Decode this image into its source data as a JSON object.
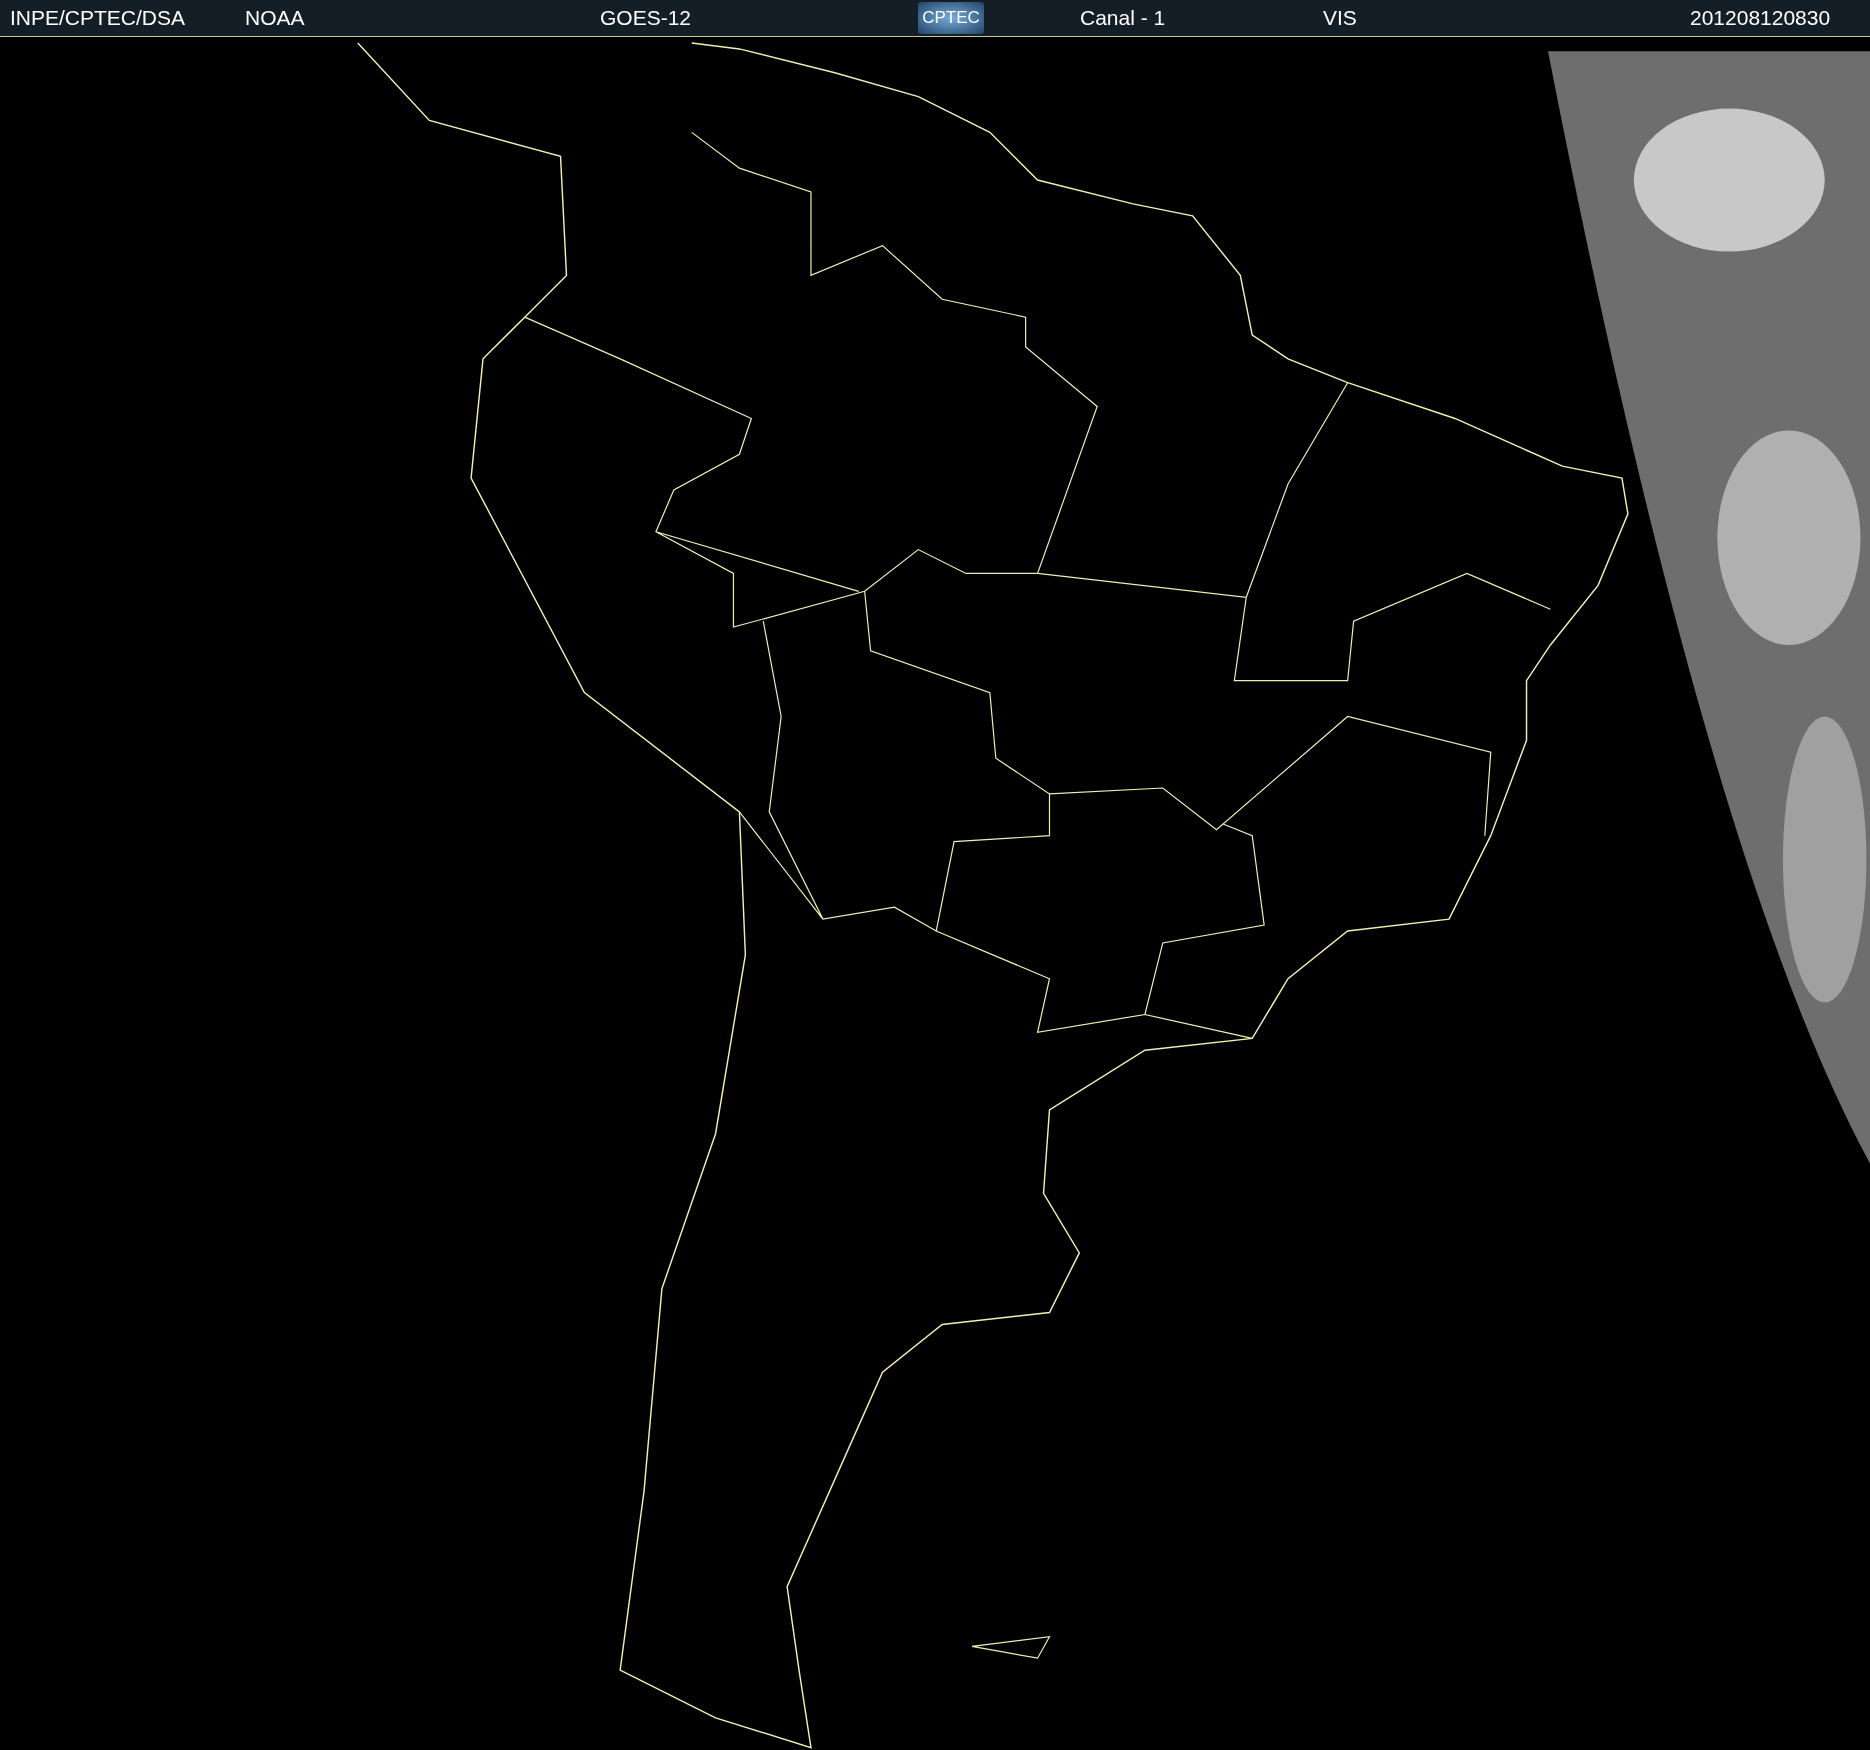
{
  "header": {
    "items": [
      {
        "kind": "text",
        "text": "INPE/CPTEC/DSA"
      },
      {
        "kind": "text",
        "text": "NOAA"
      },
      {
        "kind": "text",
        "text": "GOES-12"
      },
      {
        "kind": "logo",
        "text": "CPTEC"
      },
      {
        "kind": "text",
        "text": "Canal - 1"
      },
      {
        "kind": "text",
        "text": "VIS"
      },
      {
        "kind": "text",
        "text": "201208120830"
      }
    ]
  }
}
